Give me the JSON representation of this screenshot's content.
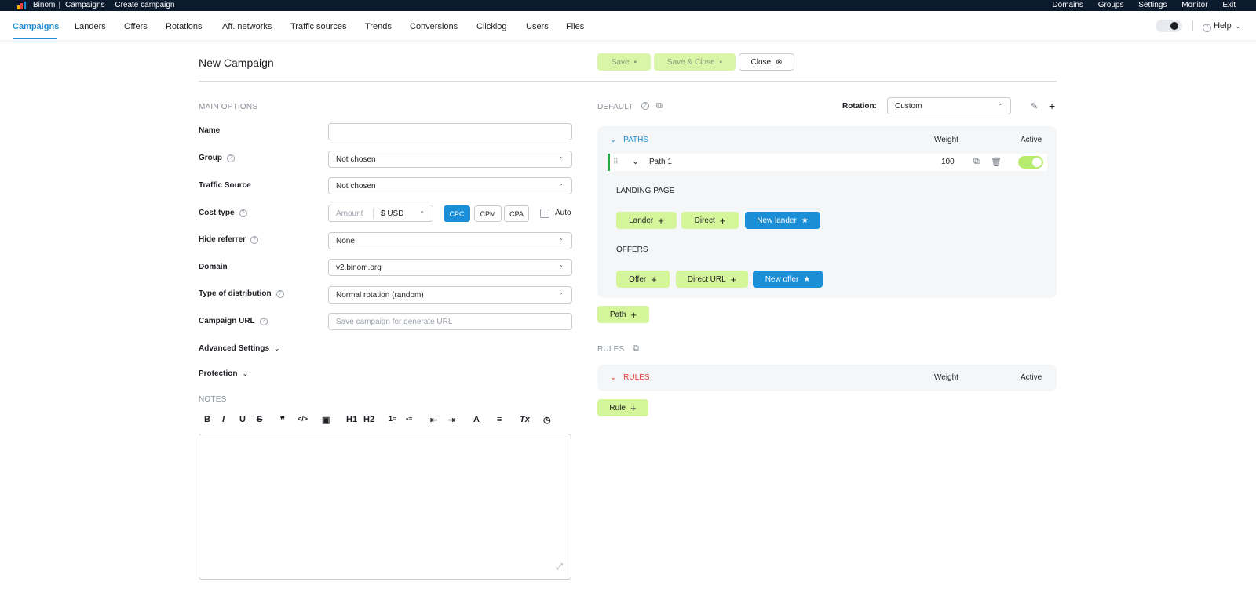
{
  "topbar": {
    "brand": "Binom",
    "breadcrumb": [
      "Campaigns",
      "Create campaign"
    ],
    "links": [
      "Domains",
      "Groups",
      "Settings",
      "Monitor",
      "Exit"
    ]
  },
  "nav": {
    "tabs": [
      "Campaigns",
      "Landers",
      "Offers",
      "Rotations",
      "Aff. networks",
      "Traffic sources",
      "Trends",
      "Conversions",
      "Clicklog",
      "Users",
      "Files"
    ],
    "help": "Help"
  },
  "header": {
    "title": "New Campaign",
    "save": "Save",
    "save_close": "Save & Close",
    "close": "Close"
  },
  "main_options": {
    "section": "MAIN OPTIONS",
    "name_label": "Name",
    "name_value": "",
    "group_label": "Group",
    "group_value": "Not chosen",
    "traffic_source_label": "Traffic Source",
    "traffic_source_value": "Not chosen",
    "cost_type_label": "Cost type",
    "amount_placeholder": "Amount",
    "currency": "$  USD",
    "cost_buttons": [
      "CPC",
      "CPM",
      "CPA"
    ],
    "auto_label": "Auto",
    "hide_referrer_label": "Hide referrer",
    "hide_referrer_value": "None",
    "domain_label": "Domain",
    "domain_value": "v2.binom.org",
    "distribution_label": "Type of distribution",
    "distribution_value": "Normal rotation (random)",
    "campaign_url_label": "Campaign URL",
    "campaign_url_placeholder": "Save campaign for generate URL",
    "advanced_settings": "Advanced Settings",
    "protection": "Protection"
  },
  "notes": {
    "section": "NOTES",
    "toolbar": [
      "B",
      "I",
      "U",
      "S",
      "❞",
      "</>",
      "▣",
      "H1",
      "H2",
      "1≡",
      "•≡",
      "⇤",
      "⇥",
      "A",
      "≡",
      "Tx",
      "◷"
    ]
  },
  "default": {
    "section": "DEFAULT",
    "rotation_label": "Rotation:",
    "rotation_value": "Custom",
    "paths_title": "PATHS",
    "weight_header": "Weight",
    "active_header": "Active",
    "path_name": "Path 1",
    "path_weight": "100",
    "path_active": true,
    "landing_page": "LANDING PAGE",
    "lander_btn": "Lander",
    "direct_btn": "Direct",
    "new_lander_btn": "New lander",
    "offers": "OFFERS",
    "offer_btn": "Offer",
    "direct_url_btn": "Direct URL",
    "new_offer_btn": "New offer",
    "path_btn": "Path"
  },
  "rules": {
    "section": "RULES",
    "rules_title": "RULES",
    "weight_header": "Weight",
    "active_header": "Active",
    "rule_btn": "Rule"
  },
  "colors": {
    "accent": "#1a8fd8",
    "green_button": "#d4f59a",
    "topbar": "#0c1a2e",
    "rules_red": "#e0443a"
  }
}
